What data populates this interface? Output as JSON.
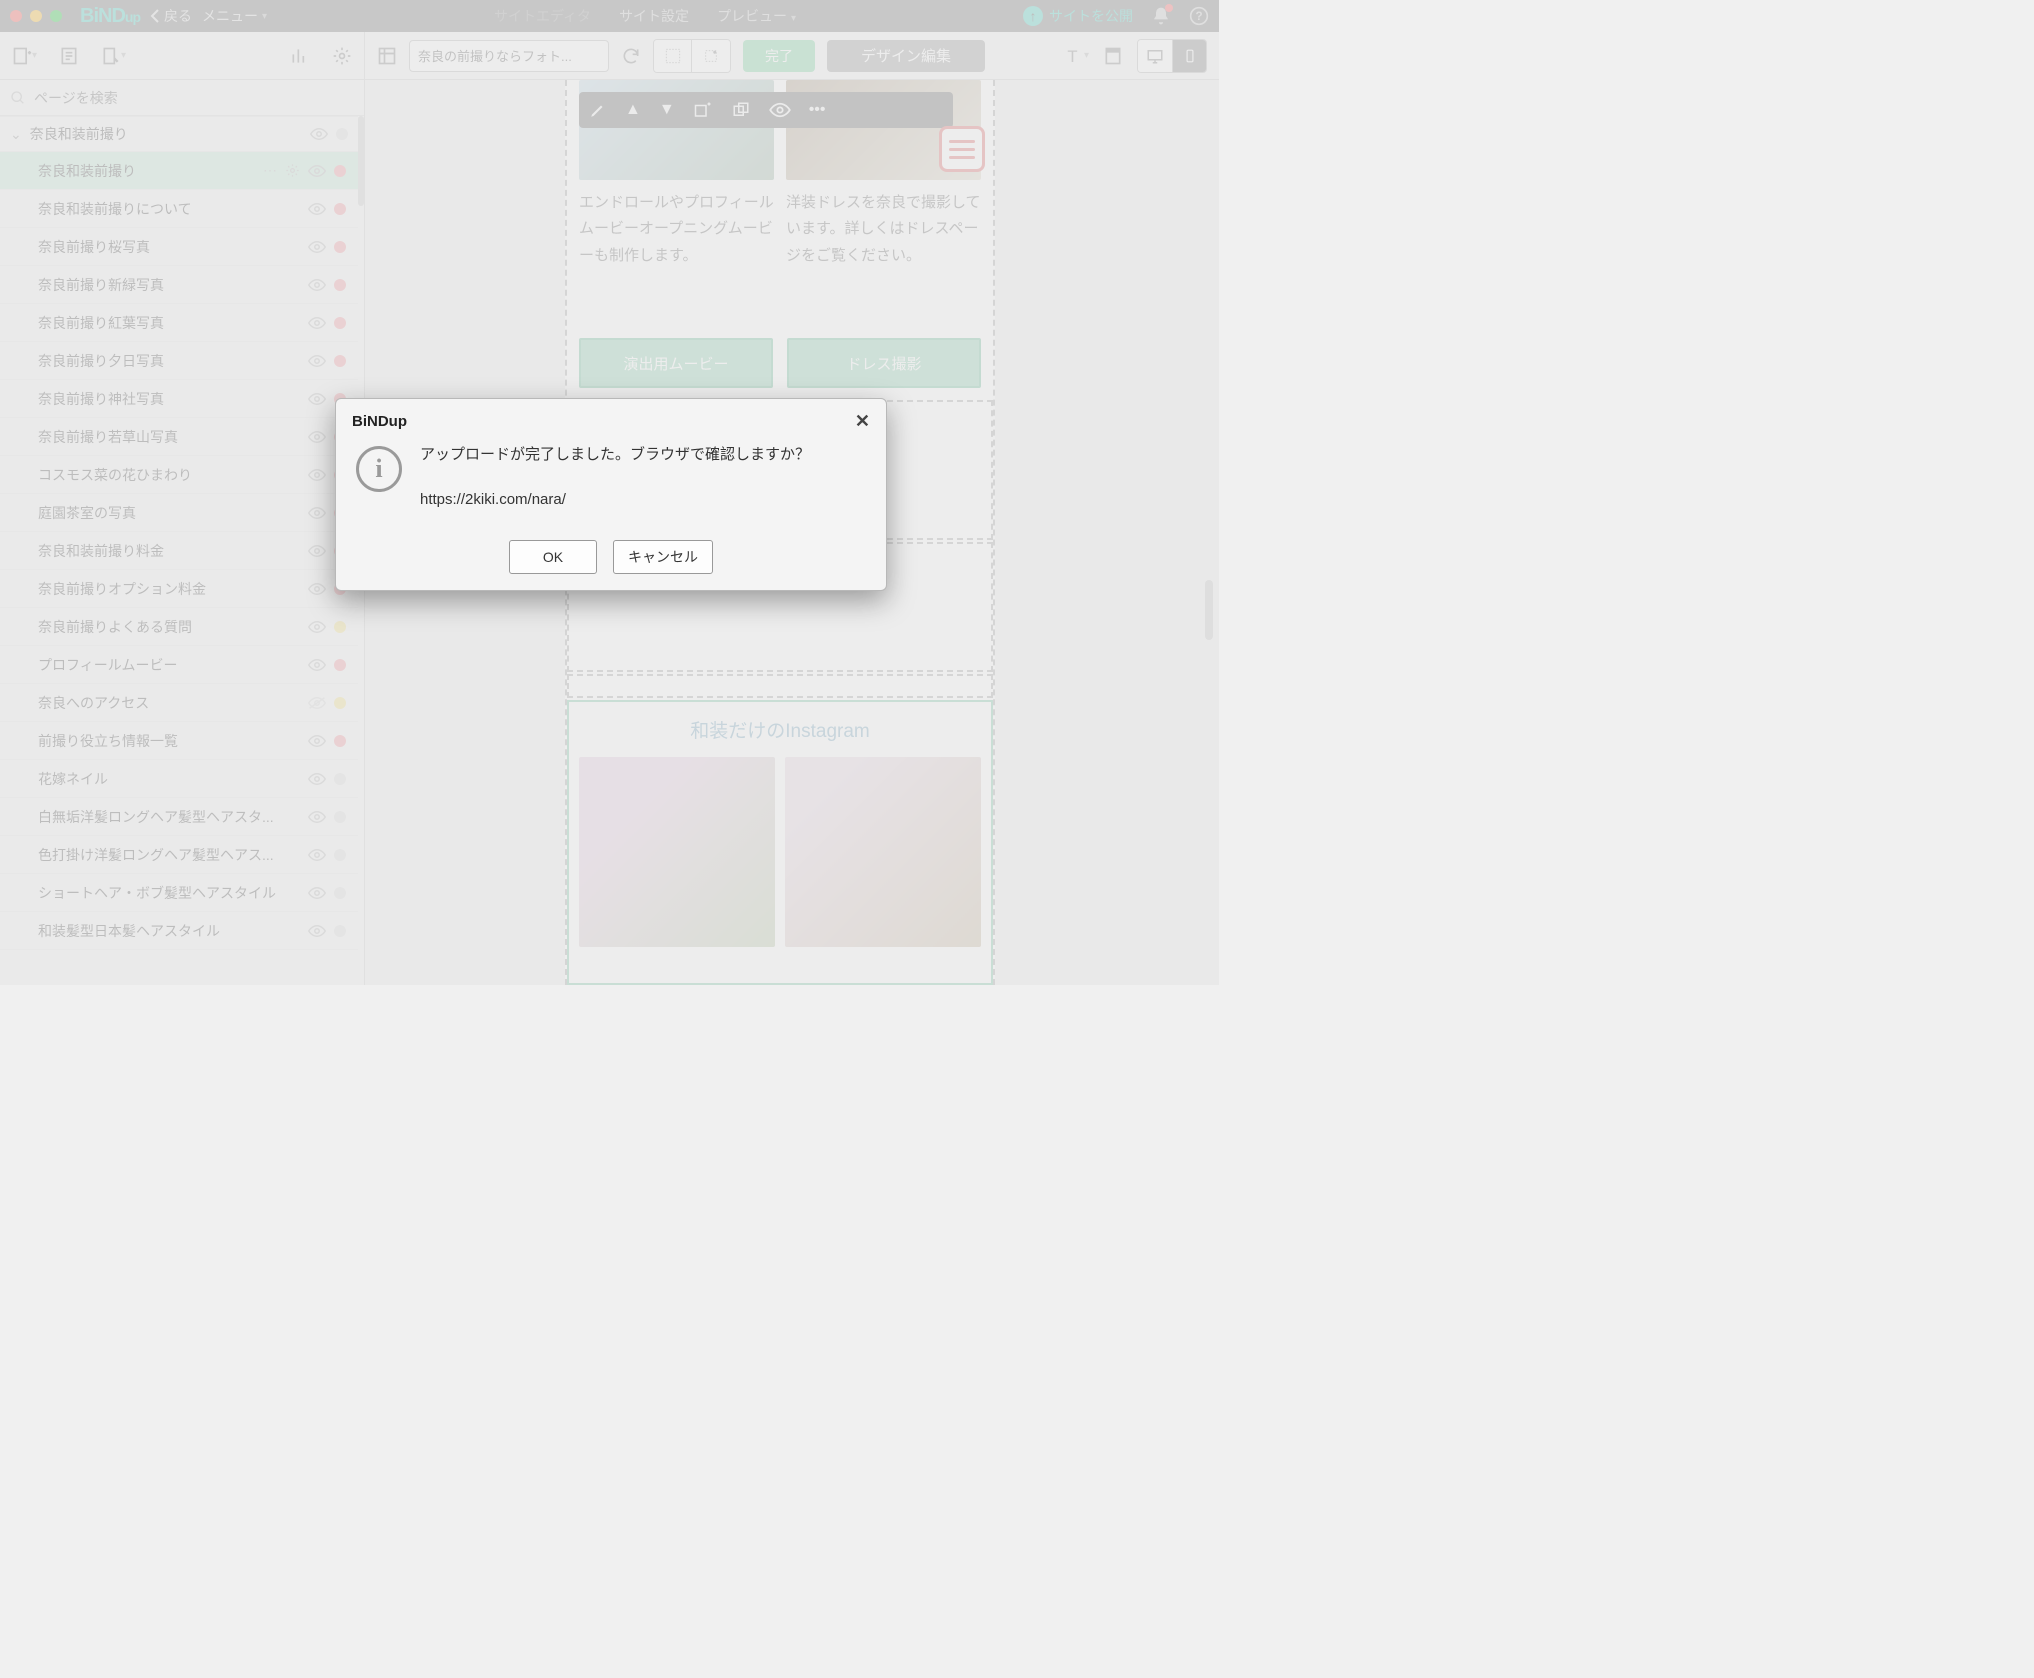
{
  "titlebar": {
    "logo_main": "BiND",
    "logo_sub": "up",
    "back": "戻る",
    "menu": "メニュー",
    "tab_editor": "サイトエディタ",
    "tab_settings": "サイト設定",
    "tab_preview": "プレビュー",
    "publish": "サイトを公開"
  },
  "toolbar": {
    "crumb": "奈良の前撮りならフォト...",
    "done": "完了",
    "design": "デザイン編集"
  },
  "search": {
    "placeholder": "ページを検索"
  },
  "site": {
    "name": "奈良和装前撮り"
  },
  "pages": [
    {
      "label": "奈良和装前撮り",
      "status": "red",
      "selected": true,
      "menu": true
    },
    {
      "label": "奈良和装前撮りについて",
      "status": "red"
    },
    {
      "label": "奈良前撮り桜写真",
      "status": "red"
    },
    {
      "label": "奈良前撮り新緑写真",
      "status": "red"
    },
    {
      "label": "奈良前撮り紅葉写真",
      "status": "red"
    },
    {
      "label": "奈良前撮り夕日写真",
      "status": "red"
    },
    {
      "label": "奈良前撮り神社写真",
      "status": "red"
    },
    {
      "label": "奈良前撮り若草山写真",
      "status": "red"
    },
    {
      "label": "コスモス菜の花ひまわり",
      "status": "red"
    },
    {
      "label": "庭園茶室の写真",
      "status": "red"
    },
    {
      "label": "奈良和装前撮り料金",
      "status": "red"
    },
    {
      "label": "奈良前撮りオプション料金",
      "status": "red"
    },
    {
      "label": "奈良前撮りよくある質問",
      "status": "yellow"
    },
    {
      "label": "プロフィールムービー",
      "status": "red"
    },
    {
      "label": "奈良へのアクセス",
      "status": "yellow",
      "hidden": true
    },
    {
      "label": "前撮り役立ち情報一覧",
      "status": "red"
    },
    {
      "label": "花嫁ネイル",
      "status": "grey"
    },
    {
      "label": "白無垢洋髪ロングヘア髪型ヘアスタ...",
      "status": "grey"
    },
    {
      "label": "色打掛け洋髪ロングヘア髪型ヘアス...",
      "status": "grey"
    },
    {
      "label": "ショートヘア・ボブ髪型ヘアスタイル",
      "status": "grey"
    },
    {
      "label": "和装髪型日本髪ヘアスタイル",
      "status": "grey"
    }
  ],
  "canvas": {
    "col1": "エンドロールやプロフィールムービーオープニングムービーも制作します。",
    "col2": "洋装ドレスを奈良で撮影しています。詳しくはドレスページをご覧ください。",
    "cta1": "演出用ムービー",
    "cta2": "ドレス撮影",
    "insta_title": "和装だけのInstagram"
  },
  "dialog": {
    "title": "BiNDup",
    "message": "アップロードが完了しました。ブラウザで確認しますか？",
    "url": "https://2kiki.com/nara/",
    "ok": "OK",
    "cancel": "キャンセル"
  }
}
